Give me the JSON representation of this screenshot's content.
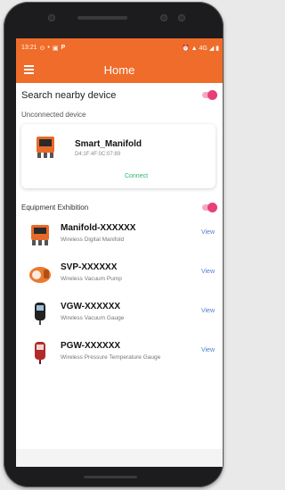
{
  "status_bar": {
    "time": "13:21",
    "left_icons": [
      "sync-icon",
      "dot-icon",
      "image-icon",
      "p-icon"
    ],
    "right_icons": [
      "alarm-icon",
      "signal-icon",
      "wifi-icon",
      "battery-icon"
    ],
    "right_text": "⏰ ▲ 4G ◢ ▮"
  },
  "app_bar": {
    "title": "Home",
    "menu_icon": "menu-icon",
    "color": "#f06c2a"
  },
  "search": {
    "label": "Search nearby device",
    "enabled": true,
    "toggle_color": "#e83f78"
  },
  "unconnected": {
    "label": "Unconnected device",
    "device": {
      "name": "Smart_Manifold",
      "mac": "D4:1F:4F:0C:07:89",
      "action": "Connect",
      "action_color": "#2bb673"
    }
  },
  "exhibition": {
    "label": "Equipment Exhibition",
    "enabled": true,
    "items": [
      {
        "name": "Manifold-XXXXXX",
        "desc": "Wireless Digital Manifold",
        "action": "View",
        "icon": "manifold-icon"
      },
      {
        "name": "SVP-XXXXXX",
        "desc": "Wireless Vacuum Pump",
        "action": "View",
        "icon": "vacuum-pump-icon"
      },
      {
        "name": "VGW-XXXXXX",
        "desc": "Wireless Vacuum Gauge",
        "action": "View",
        "icon": "vacuum-gauge-icon"
      },
      {
        "name": "PGW-XXXXXX",
        "desc": "Wireless Pressure Temperature Gauge",
        "action": "View",
        "icon": "pressure-gauge-icon"
      }
    ]
  }
}
